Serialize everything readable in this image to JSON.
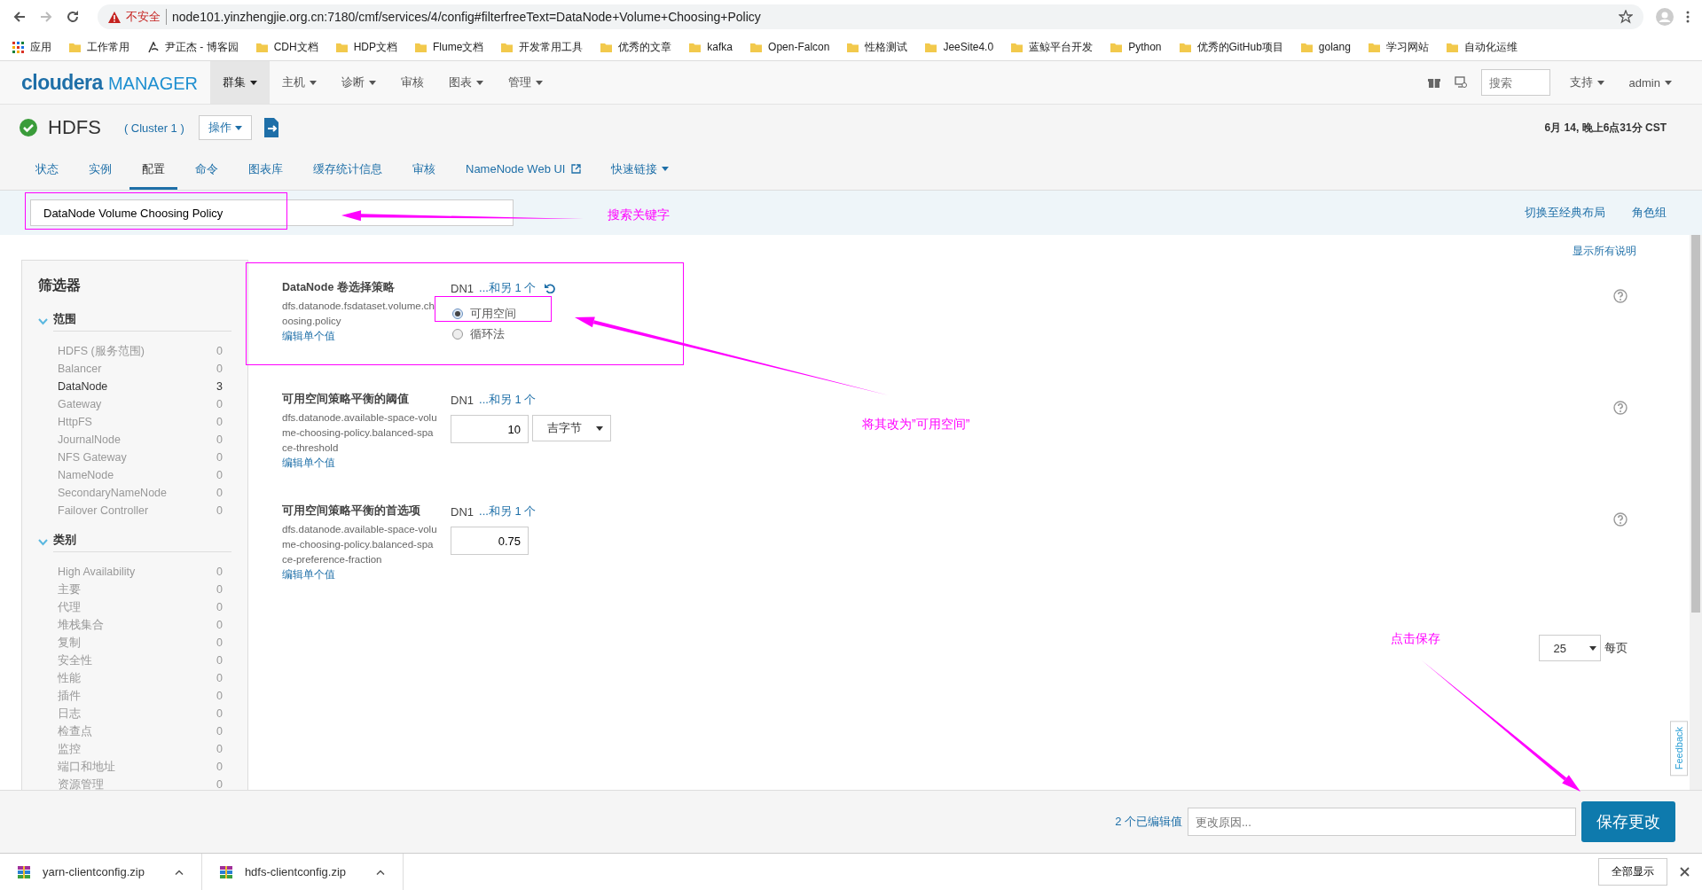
{
  "browser": {
    "security": "不安全",
    "url": "node101.yinzhengjie.org.cn:7180/cmf/services/4/config#filterfreeText=DataNode+Volume+Choosing+Policy"
  },
  "bookmarks": [
    {
      "label": "应用",
      "kind": "apps"
    },
    {
      "label": "工作常用",
      "kind": "folder"
    },
    {
      "label": "尹正杰 - 博客园",
      "kind": "site"
    },
    {
      "label": "CDH文档",
      "kind": "folder"
    },
    {
      "label": "HDP文档",
      "kind": "folder"
    },
    {
      "label": "Flume文档",
      "kind": "folder"
    },
    {
      "label": "开发常用工具",
      "kind": "folder"
    },
    {
      "label": "优秀的文章",
      "kind": "folder"
    },
    {
      "label": "kafka",
      "kind": "folder"
    },
    {
      "label": "Open-Falcon",
      "kind": "folder"
    },
    {
      "label": "性格测试",
      "kind": "folder"
    },
    {
      "label": "JeeSite4.0",
      "kind": "folder"
    },
    {
      "label": "蓝鲸平台开发",
      "kind": "folder"
    },
    {
      "label": "Python",
      "kind": "folder"
    },
    {
      "label": "优秀的GitHub项目",
      "kind": "folder"
    },
    {
      "label": "golang",
      "kind": "folder"
    },
    {
      "label": "学习网站",
      "kind": "folder"
    },
    {
      "label": "自动化运维",
      "kind": "folder"
    }
  ],
  "app_nav": {
    "logo_brand": "cloudera",
    "logo_product": "MANAGER",
    "menu": [
      {
        "label": "群集",
        "dropdown": true,
        "selected": true
      },
      {
        "label": "主机",
        "dropdown": true,
        "selected": false
      },
      {
        "label": "诊断",
        "dropdown": true,
        "selected": false
      },
      {
        "label": "审核",
        "dropdown": false,
        "selected": false
      },
      {
        "label": "图表",
        "dropdown": true,
        "selected": false
      },
      {
        "label": "管理",
        "dropdown": true,
        "selected": false
      }
    ],
    "search_placeholder": "搜索",
    "right_menu": [
      {
        "label": "支持"
      },
      {
        "label": "admin"
      }
    ]
  },
  "service": {
    "name": "HDFS",
    "healthy": true,
    "cluster": "( Cluster 1 )",
    "actions": "操作",
    "timestamp": "6月 14, 晚上6点31分 CST"
  },
  "tabs": [
    {
      "label": "状态",
      "selected": false,
      "kind": "plain"
    },
    {
      "label": "实例",
      "selected": false,
      "kind": "plain"
    },
    {
      "label": "配置",
      "selected": true,
      "kind": "plain"
    },
    {
      "label": "命令",
      "selected": false,
      "kind": "plain"
    },
    {
      "label": "图表库",
      "selected": false,
      "kind": "plain"
    },
    {
      "label": "缓存统计信息",
      "selected": false,
      "kind": "plain"
    },
    {
      "label": "审核",
      "selected": false,
      "kind": "plain"
    },
    {
      "label": "NameNode Web UI",
      "selected": false,
      "kind": "external"
    },
    {
      "label": "快速链接",
      "selected": false,
      "kind": "dropdown"
    }
  ],
  "config_search": {
    "value": "DataNode Volume Choosing Policy",
    "links": [
      "切换至经典布局",
      "角色组"
    ]
  },
  "filters": {
    "title": "筛选器",
    "groups": [
      {
        "label": "范围",
        "expanded": true,
        "items": [
          {
            "label": "HDFS (服务范围)",
            "count": "0",
            "active": false
          },
          {
            "label": "Balancer",
            "count": "0",
            "active": false
          },
          {
            "label": "DataNode",
            "count": "3",
            "active": true
          },
          {
            "label": "Gateway",
            "count": "0",
            "active": false
          },
          {
            "label": "HttpFS",
            "count": "0",
            "active": false
          },
          {
            "label": "JournalNode",
            "count": "0",
            "active": false
          },
          {
            "label": "NFS Gateway",
            "count": "0",
            "active": false
          },
          {
            "label": "NameNode",
            "count": "0",
            "active": false
          },
          {
            "label": "SecondaryNameNode",
            "count": "0",
            "active": false
          },
          {
            "label": "Failover Controller",
            "count": "0",
            "active": false
          }
        ]
      },
      {
        "label": "类别",
        "expanded": true,
        "items": [
          {
            "label": "High Availability",
            "count": "0",
            "active": false
          },
          {
            "label": "主要",
            "count": "0",
            "active": false
          },
          {
            "label": "代理",
            "count": "0",
            "active": false
          },
          {
            "label": "堆栈集合",
            "count": "0",
            "active": false
          },
          {
            "label": "复制",
            "count": "0",
            "active": false
          },
          {
            "label": "安全性",
            "count": "0",
            "active": false
          },
          {
            "label": "性能",
            "count": "0",
            "active": false
          },
          {
            "label": "插件",
            "count": "0",
            "active": false
          },
          {
            "label": "日志",
            "count": "0",
            "active": false
          },
          {
            "label": "检查点",
            "count": "0",
            "active": false
          },
          {
            "label": "监控",
            "count": "0",
            "active": false
          },
          {
            "label": "端口和地址",
            "count": "0",
            "active": false
          },
          {
            "label": "资源管理",
            "count": "0",
            "active": false
          }
        ]
      }
    ]
  },
  "show_all_descriptions": "显示所有说明",
  "configs": [
    {
      "title": "DataNode 卷选择策略",
      "property": "dfs.datanode.fsdataset.volume.choosing.policy",
      "edit_link": "编辑单个值",
      "scope": "DN1",
      "scope_more": "...和另 1 个",
      "reset": true,
      "kind": "radio",
      "options": [
        {
          "label": "可用空间",
          "selected": true
        },
        {
          "label": "循环法",
          "selected": false
        }
      ]
    },
    {
      "title": "可用空间策略平衡的阈值",
      "property": "dfs.datanode.available-space-volume-choosing-policy.balanced-space-threshold",
      "edit_link": "编辑单个值",
      "scope": "DN1",
      "scope_more": "...和另 1 个",
      "reset": false,
      "kind": "number_unit",
      "value": "10",
      "unit": "吉字节"
    },
    {
      "title": "可用空间策略平衡的首选项",
      "property": "dfs.datanode.available-space-volume-choosing-policy.balanced-space-preference-fraction",
      "edit_link": "编辑单个值",
      "scope": "DN1",
      "scope_more": "...和另 1 个",
      "reset": false,
      "kind": "number",
      "value": "0.75"
    }
  ],
  "pager": {
    "per_page": "25",
    "label": "每页"
  },
  "feedback": "Feedback",
  "footer": {
    "edited_count": "2 个已编辑值",
    "reason_placeholder": "更改原因...",
    "save": "保存更改"
  },
  "downloads": {
    "files": [
      {
        "name": "yarn-clientconfig.zip"
      },
      {
        "name": "hdfs-clientconfig.zip"
      }
    ],
    "show_all": "全部显示"
  },
  "annotations": [
    {
      "kind": "label",
      "text": "搜索关键字"
    },
    {
      "kind": "label",
      "text": "将其改为”可用空间”"
    },
    {
      "kind": "label",
      "text": "点击保存"
    }
  ]
}
